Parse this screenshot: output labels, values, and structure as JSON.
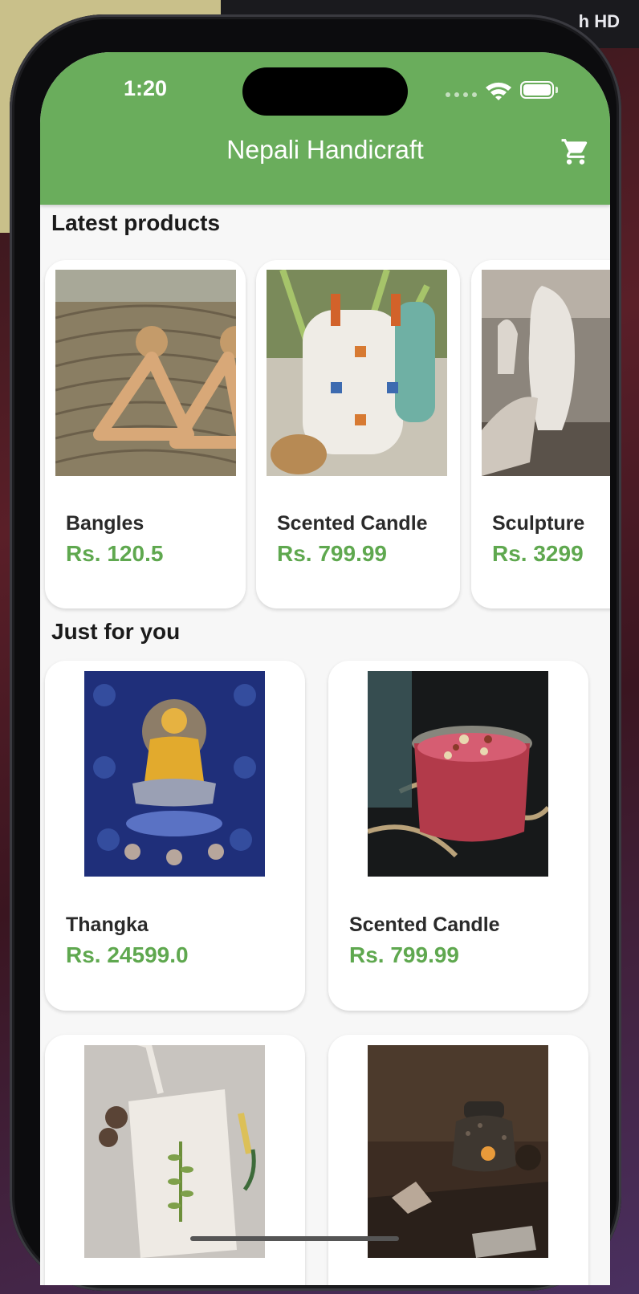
{
  "background_label": "h HD",
  "status_bar": {
    "time": "1:20"
  },
  "app_bar": {
    "title": "Nepali Handicraft",
    "action_icon": "cart-icon"
  },
  "latest": {
    "title": "Latest products",
    "items": [
      {
        "name": "Bangles",
        "price": "Rs. 120.5"
      },
      {
        "name": "Scented Candle",
        "price": "Rs. 799.99"
      },
      {
        "name": "Sculpture",
        "price": "Rs. 3299"
      }
    ]
  },
  "for_you": {
    "title": "Just for you",
    "items": [
      {
        "name": "Thangka",
        "price": "Rs. 24599.0"
      },
      {
        "name": "Scented Candle",
        "price": "Rs. 799.99"
      },
      {
        "name": "",
        "price": ""
      },
      {
        "name": "",
        "price": ""
      }
    ]
  },
  "colors": {
    "accent": "#6aad5c",
    "price": "#5fa84f"
  }
}
